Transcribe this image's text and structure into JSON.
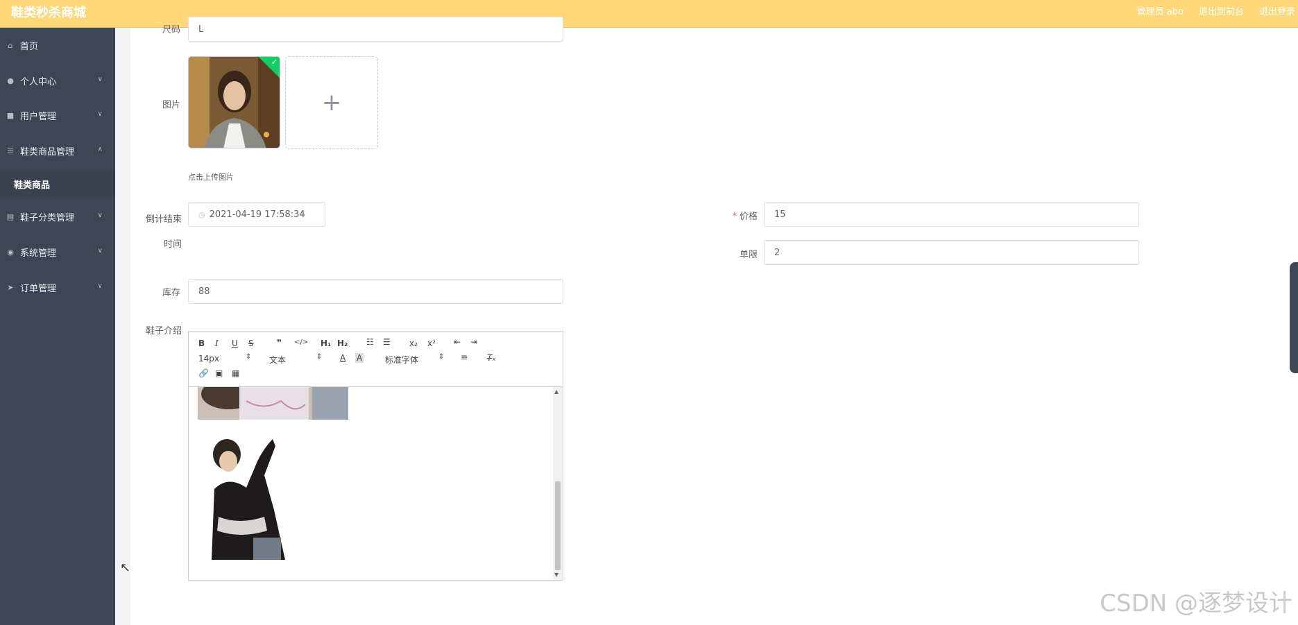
{
  "header": {
    "brand": "鞋类秒杀商城",
    "admin": "管理员 abo",
    "to_front": "退出到前台",
    "logout": "退出登录"
  },
  "sidebar": {
    "items": [
      {
        "label": "首页",
        "icon": "home-icon"
      },
      {
        "label": "个人中心",
        "icon": "user-icon"
      },
      {
        "label": "用户管理",
        "icon": "users-icon"
      },
      {
        "label": "鞋类商品管理",
        "icon": "list-icon"
      },
      {
        "label": "鞋子分类管理",
        "icon": "category-icon"
      },
      {
        "label": "系统管理",
        "icon": "settings-icon"
      },
      {
        "label": "订单管理",
        "icon": "send-icon"
      }
    ],
    "sub_item": "鞋类商品"
  },
  "form": {
    "size": {
      "label": "尺码",
      "value": "L"
    },
    "image": {
      "label": "图片",
      "hint": "点击上传图片"
    },
    "countdown": {
      "label": "倒计结束时间",
      "value": "2021-04-19 17:58:34"
    },
    "price": {
      "label": "价格",
      "value": "15",
      "required_mark": "*"
    },
    "limit": {
      "label": "单限",
      "value": "2"
    },
    "stock": {
      "label": "库存",
      "value": "88"
    },
    "intro": {
      "label": "鞋子介绍"
    }
  },
  "editor": {
    "font_size": "14px",
    "block_type": "文本",
    "font_family": "标准字体"
  },
  "watermark": "CSDN @逐梦设计"
}
